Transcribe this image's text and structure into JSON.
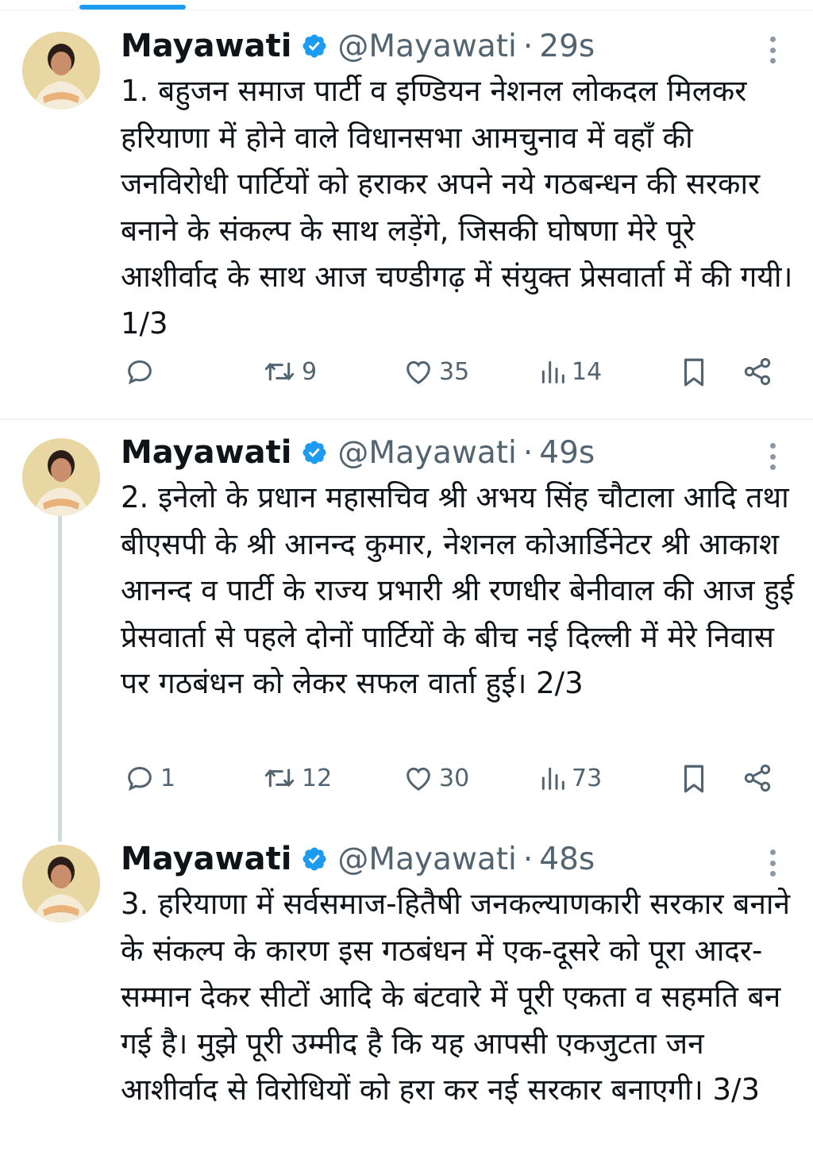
{
  "ui": {
    "accent_color": "#1d9bf0",
    "text_color": "#0f1419",
    "muted_color": "#536471",
    "icons": [
      "reply-icon",
      "retweet-icon",
      "like-icon",
      "views-icon",
      "bookmark-icon",
      "share-icon",
      "verified-badge-icon",
      "more-options-icon"
    ]
  },
  "tweets": [
    {
      "name": "Mayawati",
      "handle": "@Mayawati",
      "separator": "·",
      "time": "29s",
      "text": "1. बहुजन समाज पार्टी व इण्डियन नेशनल लोकदल मिलकर हरियाणा में होने वाले विधानसभा आमचुनाव में वहाँ की जनविरोधी पार्टियों को हराकर अपने नये गठबन्धन की सरकार बनाने के संकल्प के साथ लड़ेंगे, जिसकी घोषणा मेरे पूरे आशीर्वाद के साथ आज चण्डीगढ़ में संयुक्त प्रेसवार्ता में की गयी। 1/3",
      "replies": "",
      "retweets": "9",
      "likes": "35",
      "views": "14"
    },
    {
      "name": "Mayawati",
      "handle": "@Mayawati",
      "separator": "·",
      "time": "49s",
      "text": "2. इनेलो के प्रधान महासचिव श्री अभय सिंह चौटाला आदि तथा बीएसपी के श्री आनन्द कुमार, नेशनल कोआर्डिनेटर श्री आकाश आनन्द व पार्टी के राज्य प्रभारी श्री रणधीर बेनीवाल की आज हुई प्रेसवार्ता से पहले दोनों पार्टियों के बीच नई दिल्ली में मेरे निवास पर गठबंधन को लेकर सफल वार्ता हुई। 2/3",
      "replies": "1",
      "retweets": "12",
      "likes": "30",
      "views": "73"
    },
    {
      "name": "Mayawati",
      "handle": "@Mayawati",
      "separator": "·",
      "time": "48s",
      "text": "3. हरियाणा में सर्वसमाज-हितैषी जनकल्याणकारी सरकार बनाने के संकल्प के कारण इस गठबंधन में एक-दूसरे को पूरा आदर-सम्मान देकर सीटों आदि के बंटवारे में पूरी एकता व सहमति बन गई है। मुझे पूरी उम्मीद है कि यह आपसी एकजुटता जन आशीर्वाद से विरोधियों को हरा कर नई सरकार बनाएगी। 3/3"
    }
  ]
}
